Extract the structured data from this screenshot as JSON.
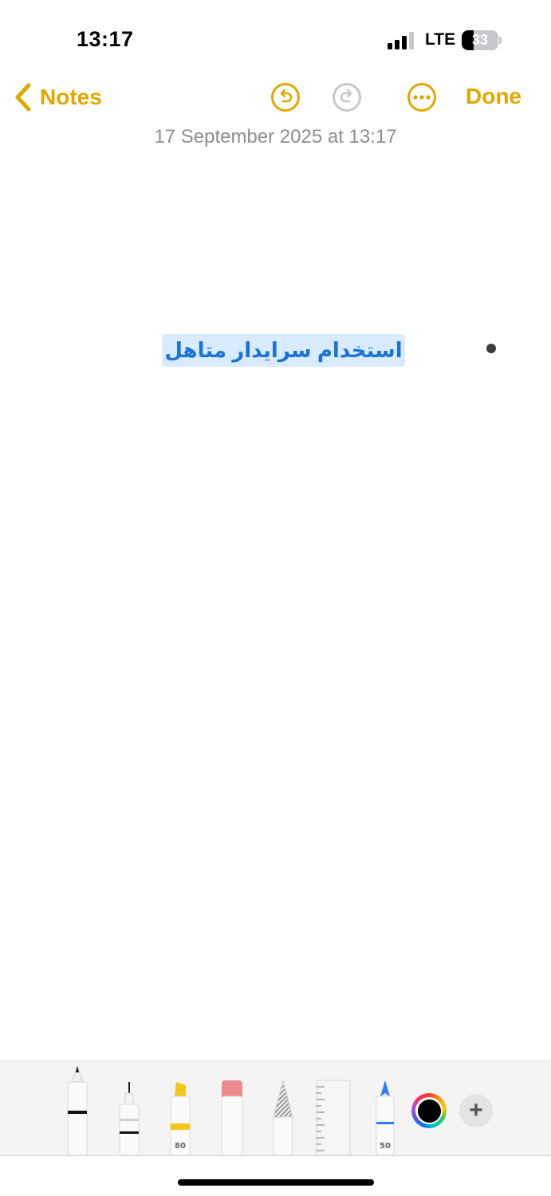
{
  "status_bar": {
    "time": "13:17",
    "network": "LTE",
    "battery_percent": "33",
    "battery_level": 0.33
  },
  "nav": {
    "back_label": "Notes",
    "done_label": "Done",
    "accent_color": "#e0a800"
  },
  "note": {
    "date": "17 September 2025 at 13:17",
    "items": [
      {
        "text": "استخدام سرایدار متاهل",
        "selected": true
      }
    ]
  },
  "toolbar": {
    "tools": [
      {
        "name": "pen",
        "label": "",
        "active": true
      },
      {
        "name": "fineliner",
        "label": ""
      },
      {
        "name": "highlighter",
        "label": "80",
        "color": "#f5c518"
      },
      {
        "name": "eraser",
        "label": ""
      },
      {
        "name": "pencil",
        "label": ""
      },
      {
        "name": "ruler",
        "label": ""
      },
      {
        "name": "marker",
        "label": "50",
        "color": "#2f7cf6"
      }
    ],
    "selected_color": "#000000",
    "add_icon": "plus-icon"
  },
  "icons": {
    "back": "chevron-left-icon",
    "undo": "undo-icon",
    "redo": "redo-icon",
    "more": "ellipsis-icon"
  }
}
